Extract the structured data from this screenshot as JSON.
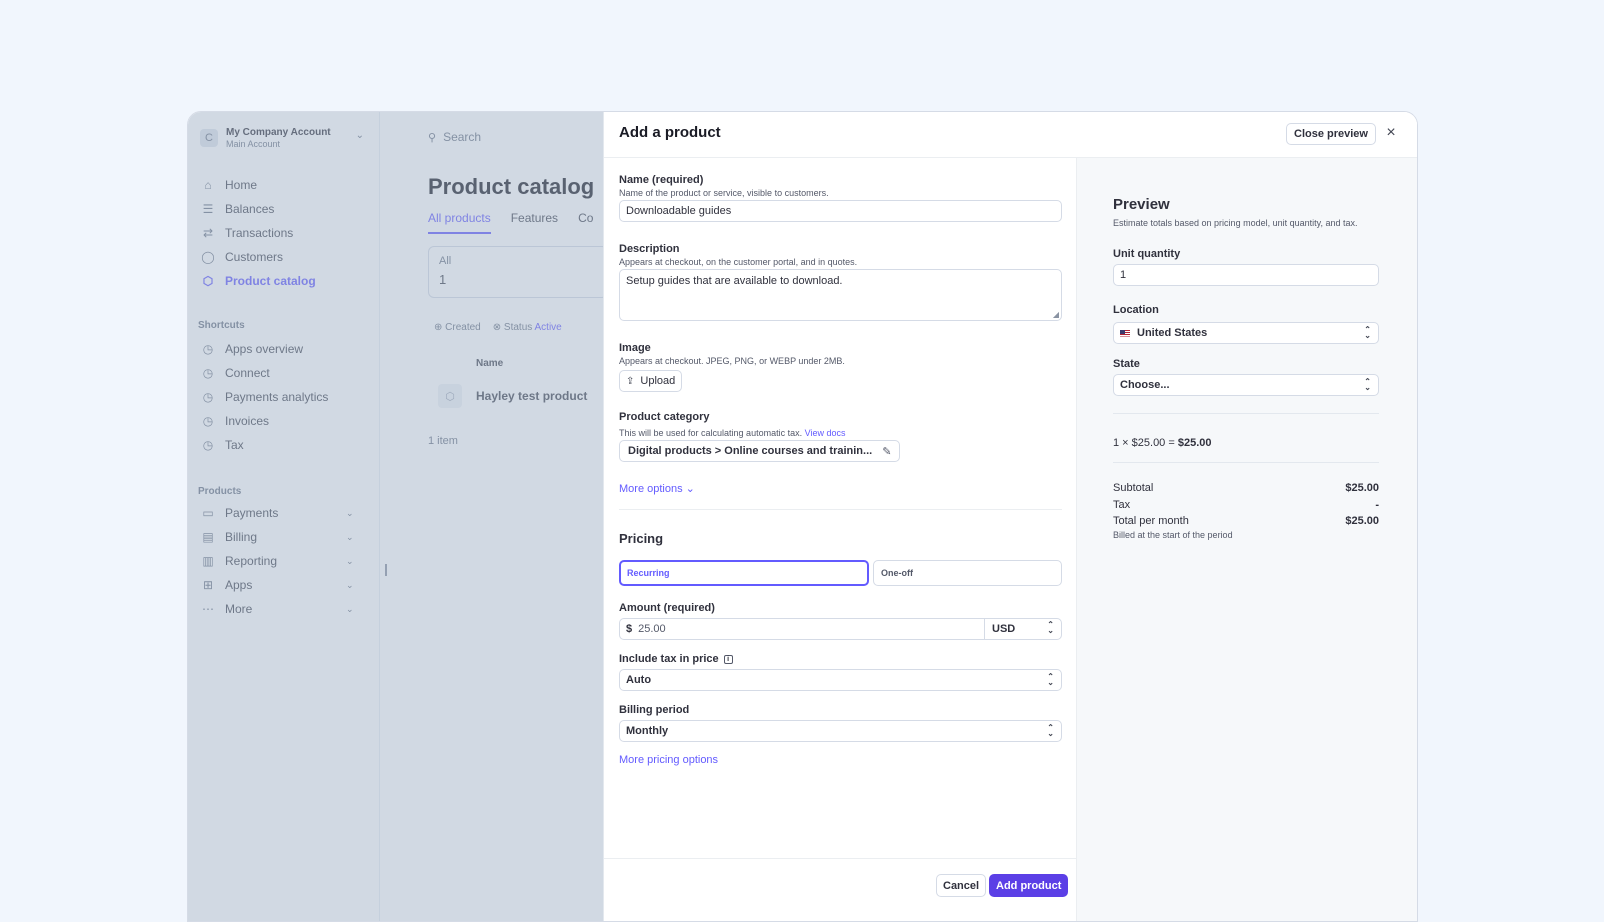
{
  "colors": {
    "accent": "#635bff",
    "primary_button": "#5b3fe6",
    "page_bg": "#f1f6fd"
  },
  "sidebar": {
    "account_name": "My Company Account",
    "account_sub": "Main Account",
    "avatar_letter": "C",
    "nav": [
      {
        "label": "Home",
        "icon": "home-icon"
      },
      {
        "label": "Balances",
        "icon": "balances-icon"
      },
      {
        "label": "Transactions",
        "icon": "transactions-icon"
      },
      {
        "label": "Customers",
        "icon": "customers-icon"
      },
      {
        "label": "Product catalog",
        "icon": "product-catalog-icon",
        "active": true
      }
    ],
    "shortcuts_title": "Shortcuts",
    "shortcuts": [
      "Apps overview",
      "Connect",
      "Payments analytics",
      "Invoices",
      "Tax"
    ],
    "products_title": "Products",
    "products": [
      "Payments",
      "Billing",
      "Reporting",
      "Apps",
      "More"
    ]
  },
  "main": {
    "search_placeholder": "Search",
    "title": "Product catalog",
    "tabs": [
      "All products",
      "Features",
      "Co"
    ],
    "stat_label": "All",
    "stat_value": "1",
    "filters": {
      "created": "Created",
      "status": "Status",
      "status_value": "Active"
    },
    "column_name": "Name",
    "product_name": "Hayley test product",
    "item_count": "1 item"
  },
  "modal": {
    "title": "Add a product",
    "close_preview": "Close preview",
    "name_label": "Name (required)",
    "name_hint": "Name of the product or service, visible to customers.",
    "name_value": "Downloadable guides",
    "desc_label": "Description",
    "desc_hint": "Appears at checkout, on the customer portal, and in quotes.",
    "desc_value": "Setup guides that are available to download.",
    "image_label": "Image",
    "image_hint": "Appears at checkout. JPEG, PNG, or WEBP under 2MB.",
    "upload_label": "Upload",
    "category_label": "Product category",
    "category_hint": "This will be used for calculating automatic tax.",
    "category_link": "View docs",
    "category_value": "Digital products > Online courses and trainin...",
    "more_options": "More options",
    "pricing_title": "Pricing",
    "pricing_options": [
      "Recurring",
      "One-off"
    ],
    "amount_label": "Amount (required)",
    "currency_symbol": "$",
    "amount_value": "25.00",
    "currency": "USD",
    "tax_label": "Include tax in price",
    "tax_value": "Auto",
    "billing_label": "Billing period",
    "billing_value": "Monthly",
    "more_pricing": "More pricing options",
    "cancel": "Cancel",
    "add_product": "Add product"
  },
  "preview": {
    "title": "Preview",
    "subtitle": "Estimate totals based on pricing model, unit quantity, and tax.",
    "unit_qty_label": "Unit quantity",
    "unit_qty_value": "1",
    "location_label": "Location",
    "location_value": "United States",
    "state_label": "State",
    "state_value": "Choose...",
    "calc_prefix": "1 × $25.00 =",
    "calc_total": "$25.00",
    "subtotal_label": "Subtotal",
    "subtotal_value": "$25.00",
    "tax_label": "Tax",
    "tax_value": "-",
    "total_label": "Total per month",
    "total_value": "$25.00",
    "billed_note": "Billed at the start of the period"
  }
}
